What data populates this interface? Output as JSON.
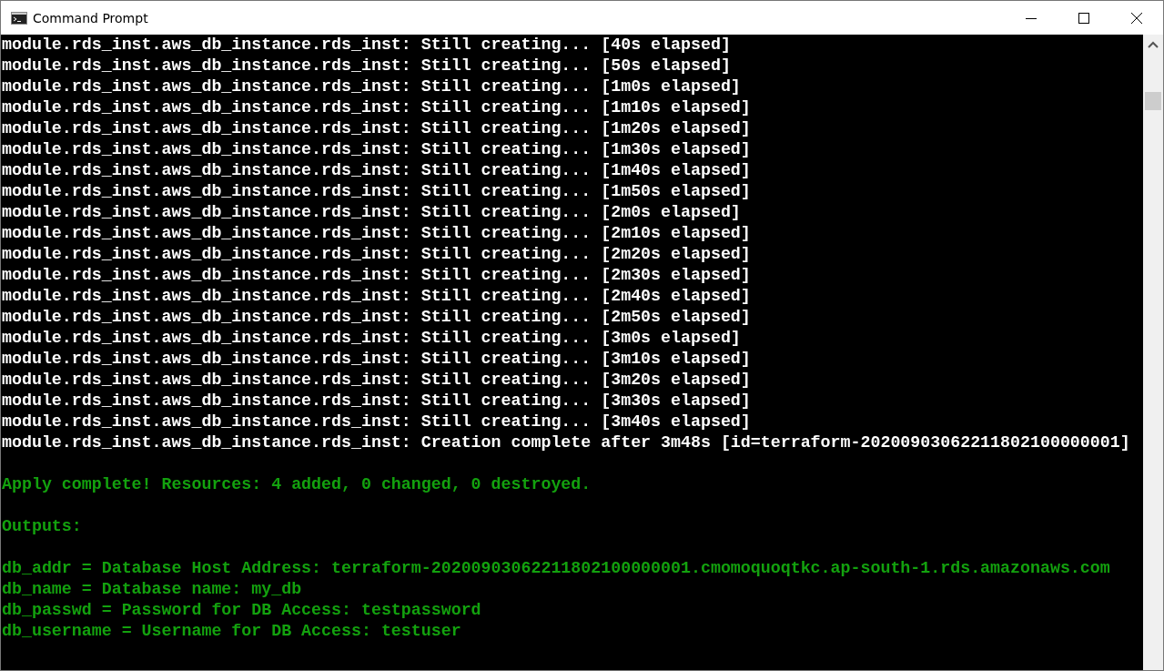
{
  "window": {
    "title": "Command Prompt"
  },
  "console_lines": [
    {
      "kind": "log",
      "text": "module.rds_inst.aws_db_instance.rds_inst: Still creating... [40s elapsed]"
    },
    {
      "kind": "log",
      "text": "module.rds_inst.aws_db_instance.rds_inst: Still creating... [50s elapsed]"
    },
    {
      "kind": "log",
      "text": "module.rds_inst.aws_db_instance.rds_inst: Still creating... [1m0s elapsed]"
    },
    {
      "kind": "log",
      "text": "module.rds_inst.aws_db_instance.rds_inst: Still creating... [1m10s elapsed]"
    },
    {
      "kind": "log",
      "text": "module.rds_inst.aws_db_instance.rds_inst: Still creating... [1m20s elapsed]"
    },
    {
      "kind": "log",
      "text": "module.rds_inst.aws_db_instance.rds_inst: Still creating... [1m30s elapsed]"
    },
    {
      "kind": "log",
      "text": "module.rds_inst.aws_db_instance.rds_inst: Still creating... [1m40s elapsed]"
    },
    {
      "kind": "log",
      "text": "module.rds_inst.aws_db_instance.rds_inst: Still creating... [1m50s elapsed]"
    },
    {
      "kind": "log",
      "text": "module.rds_inst.aws_db_instance.rds_inst: Still creating... [2m0s elapsed]"
    },
    {
      "kind": "log",
      "text": "module.rds_inst.aws_db_instance.rds_inst: Still creating... [2m10s elapsed]"
    },
    {
      "kind": "log",
      "text": "module.rds_inst.aws_db_instance.rds_inst: Still creating... [2m20s elapsed]"
    },
    {
      "kind": "log",
      "text": "module.rds_inst.aws_db_instance.rds_inst: Still creating... [2m30s elapsed]"
    },
    {
      "kind": "log",
      "text": "module.rds_inst.aws_db_instance.rds_inst: Still creating... [2m40s elapsed]"
    },
    {
      "kind": "log",
      "text": "module.rds_inst.aws_db_instance.rds_inst: Still creating... [2m50s elapsed]"
    },
    {
      "kind": "log",
      "text": "module.rds_inst.aws_db_instance.rds_inst: Still creating... [3m0s elapsed]"
    },
    {
      "kind": "log",
      "text": "module.rds_inst.aws_db_instance.rds_inst: Still creating... [3m10s elapsed]"
    },
    {
      "kind": "log",
      "text": "module.rds_inst.aws_db_instance.rds_inst: Still creating... [3m20s elapsed]"
    },
    {
      "kind": "log",
      "text": "module.rds_inst.aws_db_instance.rds_inst: Still creating... [3m30s elapsed]"
    },
    {
      "kind": "log",
      "text": "module.rds_inst.aws_db_instance.rds_inst: Still creating... [3m40s elapsed]"
    },
    {
      "kind": "log",
      "text": "module.rds_inst.aws_db_instance.rds_inst: Creation complete after 3m48s [id=terraform-20200903062211802100000001]"
    },
    {
      "kind": "blank"
    },
    {
      "kind": "summary",
      "text": "Apply complete! Resources: 4 added, 0 changed, 0 destroyed."
    },
    {
      "kind": "blank"
    },
    {
      "kind": "summary",
      "text": "Outputs:"
    },
    {
      "kind": "blank"
    },
    {
      "kind": "summary",
      "text": "db_addr = Database Host Address: terraform-20200903062211802100000001.cmomoquoqtkc.ap-south-1.rds.amazonaws.com"
    },
    {
      "kind": "summary",
      "text": "db_name = Database name: my_db"
    },
    {
      "kind": "summary",
      "text": "db_passwd = Password for DB Access: testpassword"
    },
    {
      "kind": "summary",
      "text": "db_username = Username for DB Access: testuser"
    }
  ]
}
